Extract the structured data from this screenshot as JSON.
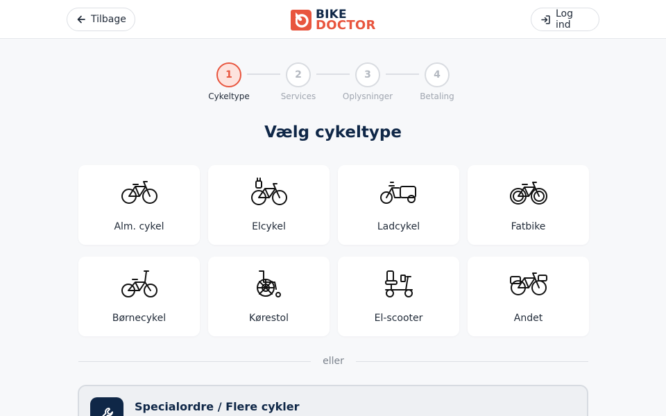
{
  "header": {
    "back_label": "Tilbage",
    "login_label": "Log ind",
    "logo_line1": "BIKE",
    "logo_line2": "DOCTOR"
  },
  "colors": {
    "brand_red": "#e8553e",
    "brand_navy": "#0f2747",
    "active_step_bg": "#fde3de"
  },
  "stepper": {
    "steps": [
      {
        "number": "1",
        "label": "Cykeltype",
        "active": true
      },
      {
        "number": "2",
        "label": "Services",
        "active": false
      },
      {
        "number": "3",
        "label": "Oplysninger",
        "active": false
      },
      {
        "number": "4",
        "label": "Betaling",
        "active": false
      }
    ]
  },
  "main": {
    "heading": "Vælg cykeltype",
    "bike_types": [
      {
        "label": "Alm. cykel",
        "icon": "bicycle-icon"
      },
      {
        "label": "Elcykel",
        "icon": "electric-bike-icon"
      },
      {
        "label": "Ladcykel",
        "icon": "cargo-bike-icon"
      },
      {
        "label": "Fatbike",
        "icon": "fatbike-icon"
      },
      {
        "label": "Børnecykel",
        "icon": "kids-bike-icon"
      },
      {
        "label": "Kørestol",
        "icon": "wheelchair-icon"
      },
      {
        "label": "El-scooter",
        "icon": "mobility-scooter-icon"
      },
      {
        "label": "Andet",
        "icon": "bike-with-baskets-icon"
      }
    ],
    "divider_text": "eller",
    "special_order": {
      "title": "Specialordre / Flere cykler",
      "icon": "wrench-icon"
    }
  }
}
